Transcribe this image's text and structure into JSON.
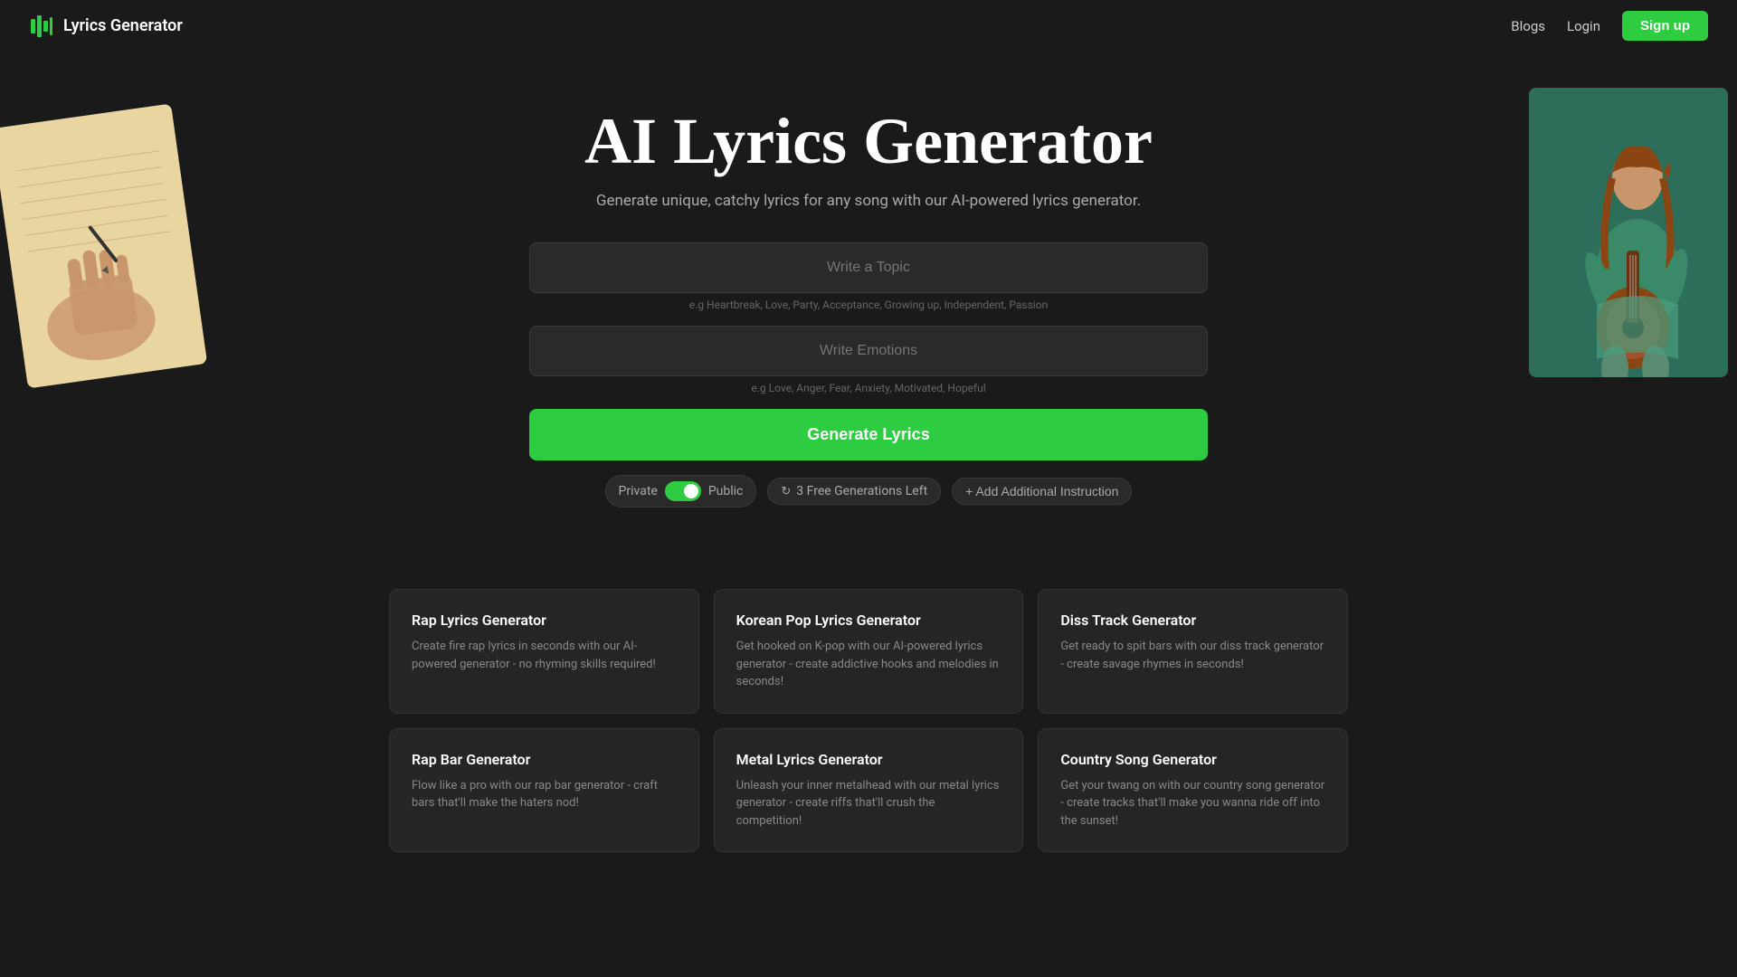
{
  "brand": {
    "logo_text": "Lyrics Generator",
    "logo_icon": "music-bars"
  },
  "navbar": {
    "blogs_label": "Blogs",
    "login_label": "Login",
    "signup_label": "Sign up"
  },
  "hero": {
    "title": "AI Lyrics Generator",
    "subtitle": "Generate unique, catchy lyrics for any song with our AI-powered lyrics generator."
  },
  "form": {
    "topic_placeholder": "Write a Topic",
    "topic_hint": "e.g Heartbreak, Love, Party, Acceptance, Growing up, Independent, Passion",
    "emotions_placeholder": "Write Emotions",
    "emotions_hint": "e.g Love, Anger, Fear, Anxiety, Motivated, Hopeful",
    "generate_label": "Generate Lyrics"
  },
  "controls": {
    "private_label": "Private",
    "public_label": "Public",
    "generations_label": "3 Free Generations Left",
    "add_instruction_label": "+ Add Additional Instruction",
    "refresh_icon": "↻"
  },
  "cards": [
    {
      "title": "Rap Lyrics Generator",
      "description": "Create fire rap lyrics in seconds with our AI-powered generator - no rhyming skills required!"
    },
    {
      "title": "Korean Pop Lyrics Generator",
      "description": "Get hooked on K-pop with our AI-powered lyrics generator - create addictive hooks and melodies in seconds!"
    },
    {
      "title": "Diss Track Generator",
      "description": "Get ready to spit bars with our diss track generator - create savage rhymes in seconds!"
    },
    {
      "title": "Rap Bar Generator",
      "description": "Flow like a pro with our rap bar generator - craft bars that'll make the haters nod!"
    },
    {
      "title": "Metal Lyrics Generator",
      "description": "Unleash your inner metalhead with our metal lyrics generator - create riffs that'll crush the competition!"
    },
    {
      "title": "Country Song Generator",
      "description": "Get your twang on with our country song generator - create tracks that'll make you wanna ride off into the sunset!"
    }
  ]
}
